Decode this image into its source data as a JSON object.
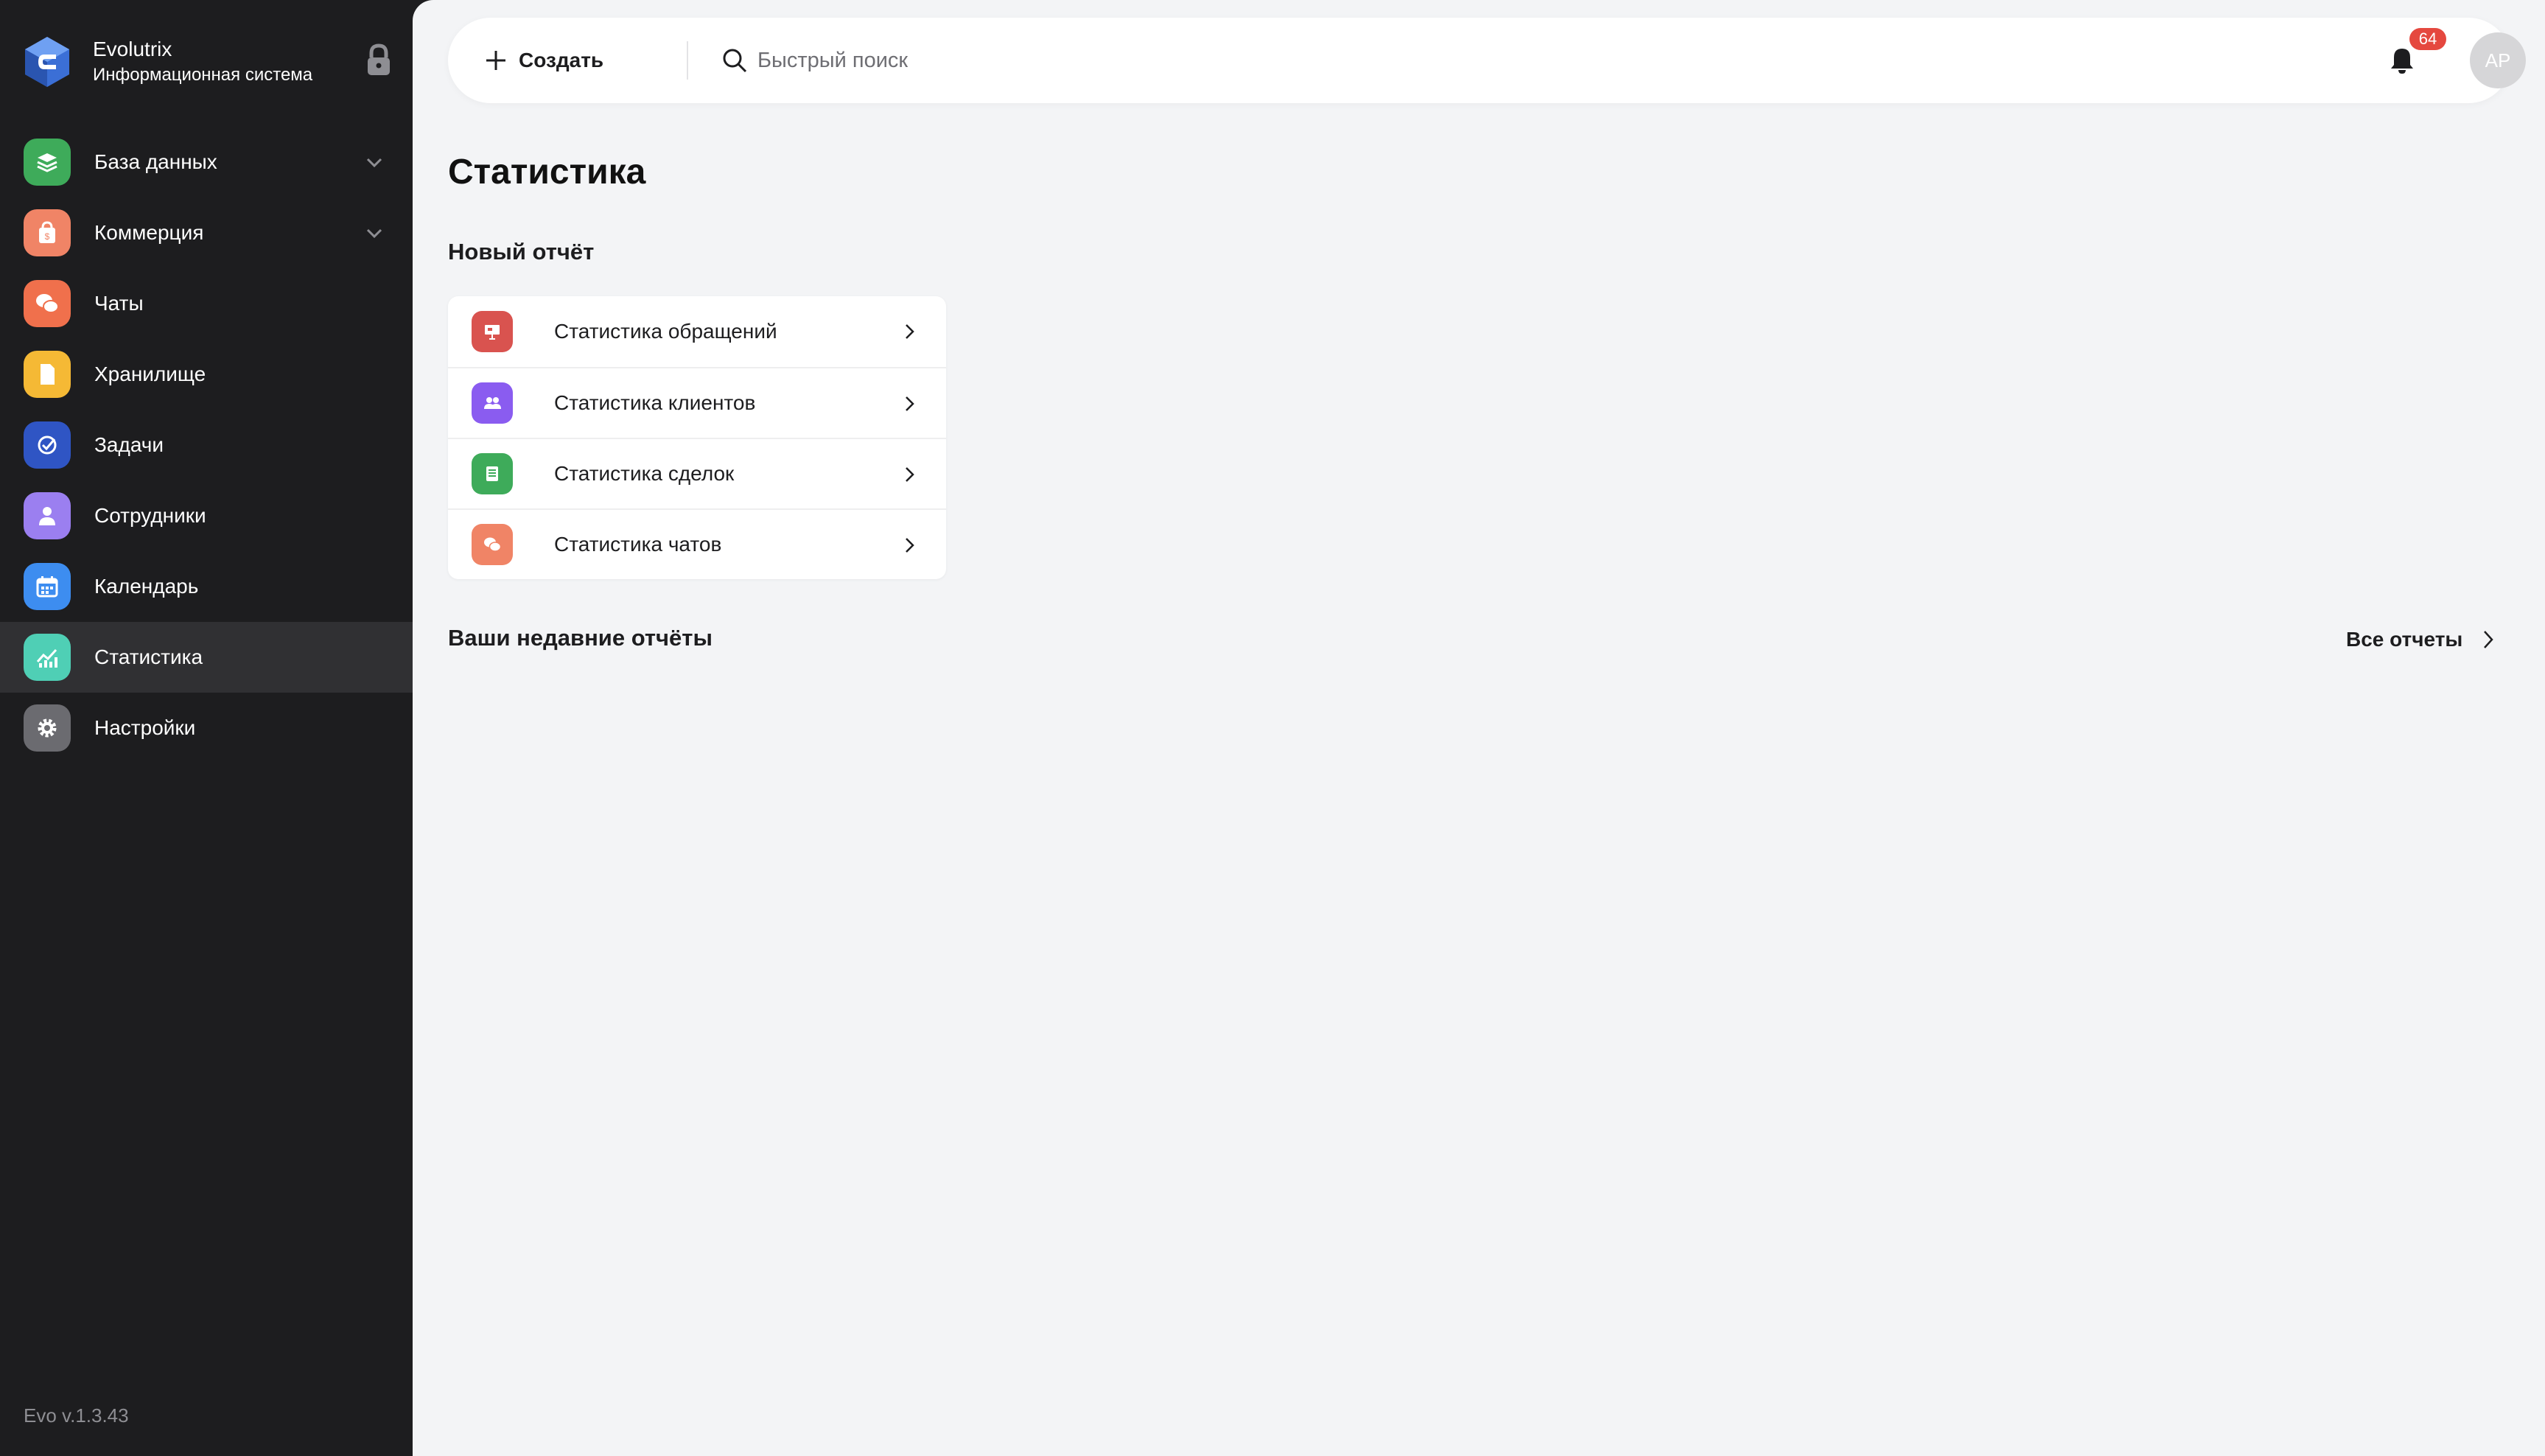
{
  "brand": {
    "name": "Evolutrix",
    "subtitle": "Информационная система"
  },
  "sidebar": {
    "items": [
      {
        "label": "База данных",
        "icon": "layers-icon",
        "color": "#3eab5a",
        "expandable": true
      },
      {
        "label": "Коммерция",
        "icon": "shopping-bag-icon",
        "color": "#f08466",
        "expandable": true
      },
      {
        "label": "Чаты",
        "icon": "chat-bubbles-icon",
        "color": "#f0704c",
        "expandable": false
      },
      {
        "label": "Хранилище",
        "icon": "document-icon",
        "color": "#f5b935",
        "expandable": false
      },
      {
        "label": "Задачи",
        "icon": "check-circle-icon",
        "color": "#2f55c4",
        "expandable": false
      },
      {
        "label": "Сотрудники",
        "icon": "person-icon",
        "color": "#9b7ff0",
        "expandable": false
      },
      {
        "label": "Календарь",
        "icon": "calendar-icon",
        "color": "#3d8df0",
        "expandable": false
      },
      {
        "label": "Статистика",
        "icon": "chart-icon",
        "color": "#4fcfb5",
        "expandable": false,
        "active": true
      },
      {
        "label": "Настройки",
        "icon": "gear-icon",
        "color": "#6b6b70",
        "expandable": false
      }
    ],
    "version": "Evo v.1.3.43"
  },
  "topbar": {
    "create_label": "Создать",
    "search_placeholder": "Быстрый поиск",
    "notifications_count": "64",
    "avatar_initials": "AP"
  },
  "main": {
    "title": "Статистика",
    "new_report_title": "Новый отчёт",
    "reports": [
      {
        "label": "Статистика обращений",
        "icon": "presentation-icon",
        "color": "#d9534f"
      },
      {
        "label": "Статистика клиентов",
        "icon": "people-icon",
        "color": "#8a5cf0"
      },
      {
        "label": "Статистика сделок",
        "icon": "list-icon",
        "color": "#3eab5a"
      },
      {
        "label": "Статистика чатов",
        "icon": "chat-bubbles-icon",
        "color": "#f08466"
      }
    ],
    "recent_title": "Ваши недавние отчёты",
    "all_reports_label": "Все отчеты"
  }
}
